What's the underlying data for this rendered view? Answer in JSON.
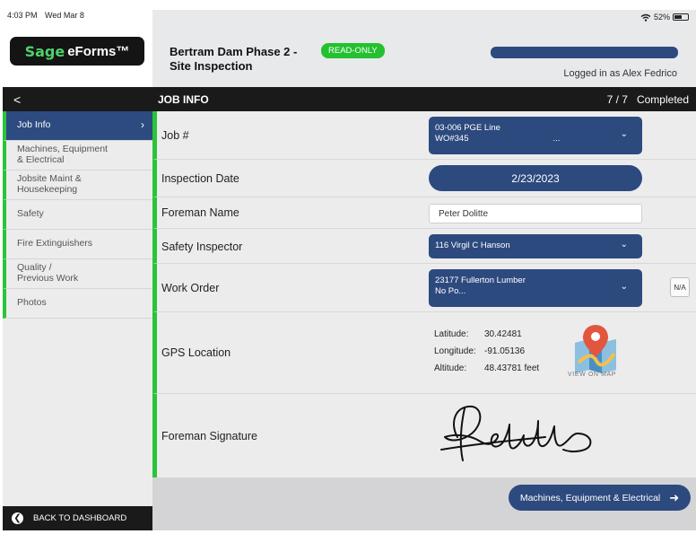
{
  "statusbar": {
    "time": "4:03 PM",
    "date": "Wed Mar 8",
    "battery": "52%"
  },
  "brand": {
    "logo_sage": "Sage",
    "logo_eforms": "eForms™"
  },
  "doc": {
    "title_line1": "Bertram Dam Phase 2 -",
    "title_line2": "Site Inspection",
    "badge": "READ-ONLY",
    "progress": 1.0,
    "logged_in": "Logged in as Alex Fedrico"
  },
  "nav": {
    "back_glyph": "<",
    "back_dashboard": "BACK TO DASHBOARD"
  },
  "sidebar": {
    "items": [
      {
        "label": "Job Info",
        "active": true
      },
      {
        "label": "Machines, Equipment",
        "label2": "& Electrical"
      },
      {
        "label": "Jobsite Maint &",
        "label2": "Housekeeping"
      },
      {
        "label": "Safety"
      },
      {
        "label": "Fire Extinguishers"
      },
      {
        "label": "Quality /",
        "label2": "Previous Work"
      },
      {
        "label": "Photos"
      }
    ]
  },
  "section": {
    "title": "JOB INFO",
    "count": "7 / 7",
    "status": "Completed"
  },
  "form": {
    "job": {
      "label": "Job #",
      "line1": "03-006    PGE Line",
      "line2": "WO#345",
      "ellipsis": "..."
    },
    "inspection_date": {
      "label": "Inspection Date",
      "value": "2/23/2023"
    },
    "foreman_name": {
      "label": "Foreman Name",
      "value": "Peter Dolitte"
    },
    "safety_inspector": {
      "label": "Safety Inspector",
      "value": "116    Virgil C  Hanson"
    },
    "work_order": {
      "label": "Work Order",
      "line1": "23177    Fullerton Lumber",
      "line2": "No Po...",
      "na": "N/A"
    },
    "gps": {
      "label": "GPS Location",
      "latitude_label": "Latitude:",
      "latitude": "30.42481",
      "longitude_label": "Longitude:",
      "longitude": "-91.05136",
      "altitude_label": "Altitude:",
      "altitude": "48.43781 feet",
      "map_caption": "VIEW ON MAP"
    },
    "signature": {
      "label": "Foreman Signature"
    }
  },
  "footer": {
    "next_label": "Machines, Equipment & Electrical"
  },
  "colors": {
    "navy": "#2d4a7f",
    "green": "#29c43a",
    "badge_green": "#23c12f"
  }
}
